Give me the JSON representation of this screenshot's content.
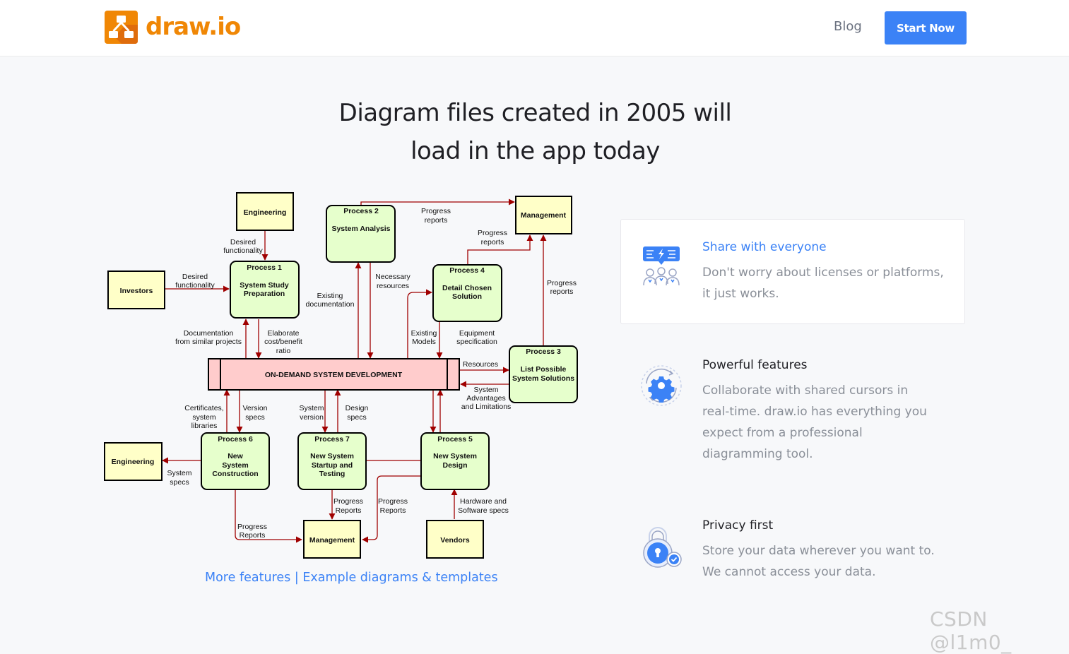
{
  "header": {
    "brand": "draw.io",
    "blog_label": "Blog",
    "start_label": "Start Now"
  },
  "hero": {
    "line1": "Diagram files created in 2005 will",
    "line2": "load in the app today"
  },
  "diagram": {
    "engineering_top": "Engineering",
    "investors": "Investors",
    "management_top": "Management",
    "p1_num": "Process 1",
    "p1_a": "System Study",
    "p1_b": "Preparation",
    "p2_num": "Process 2",
    "p2_a": "System Analysis",
    "p3_num": "Process 3",
    "p3_a": "List Possible",
    "p3_b": "System Solutions",
    "p4_num": "Process 4",
    "p4_a": "Detail Chosen",
    "p4_b": "Solution",
    "p5_num": "Process 5",
    "p5_a": "New System",
    "p5_b": "Design",
    "p6_num": "Process 6",
    "p6_a": "New",
    "p6_b": "System",
    "p6_c": "Construction",
    "p7_num": "Process 7",
    "p7_a": "New System",
    "p7_b": "Startup and",
    "p7_c": "Testing",
    "central": "ON-DEMAND SYSTEM DEVELOPMENT",
    "engineering_bottom": "Engineering",
    "management_bottom": "Management",
    "vendors": "Vendors",
    "l_desired1_a": "Desired",
    "l_desired1_b": "functionality",
    "l_desired2_a": "Desired",
    "l_desired2_b": "functionality",
    "l_progress_top_a": "Progress",
    "l_progress_top_b": "reports",
    "l_progress_p4_a": "Progress",
    "l_progress_p4_b": "reports",
    "l_progress_p3_a": "Progress",
    "l_progress_p3_b": "reports",
    "l_necessary_a": "Necessary",
    "l_necessary_b": "resources",
    "l_existing_doc_a": "Existing",
    "l_existing_doc_b": "documentation",
    "l_docsim_a": "Documentation",
    "l_docsim_b": "from similar projects",
    "l_elab_a": "Elaborate",
    "l_elab_b": "cost/benefit",
    "l_elab_c": "ratio",
    "l_existing_models_a": "Existing",
    "l_existing_models_b": "Models",
    "l_equipment_a": "Equipment",
    "l_equipment_b": "specification",
    "l_resources": "Resources",
    "l_sysadv_a": "System",
    "l_sysadv_b": "Advantages",
    "l_sysadv_c": "and Limitations",
    "l_cert_a": "Certificates,",
    "l_cert_b": "system",
    "l_cert_c": "libraries",
    "l_version_a": "Version",
    "l_version_b": "specs",
    "l_sysver_a": "System",
    "l_sysver_b": "version",
    "l_design_a": "Design",
    "l_design_b": "specs",
    "l_sysspecs_a": "System",
    "l_sysspecs_b": "specs",
    "l_prog7_a": "Progress",
    "l_prog7_b": "Reports",
    "l_prog5_a": "Progress",
    "l_prog5_b": "Reports",
    "l_prog6_a": "Progress",
    "l_prog6_b": "Reports",
    "l_hw_a": "Hardware and",
    "l_hw_b": "Software specs"
  },
  "links": {
    "more_features": "More features",
    "separator": "|",
    "examples": "Example diagrams & templates"
  },
  "features": [
    {
      "title": "Share with everyone",
      "desc1": "Don't worry about licenses or platforms,",
      "desc2": "it just works."
    },
    {
      "title": "Powerful features",
      "desc1": "Collaborate with shared cursors in",
      "desc2": "real-time. draw.io has everything you",
      "desc3": "expect from a professional",
      "desc4": "diagramming tool."
    },
    {
      "title": "Privacy first",
      "desc1": "Store your data wherever you want to.",
      "desc2": "We cannot access your data."
    }
  ],
  "watermark": "CSDN @l1m0_",
  "colors": {
    "accent": "#3b82f6",
    "brand_orange": "#f08705",
    "arrow": "#a00000",
    "entity_fill": "#ffffc8",
    "process_fill": "#e6ffcc",
    "central_fill": "#ffcccc"
  }
}
